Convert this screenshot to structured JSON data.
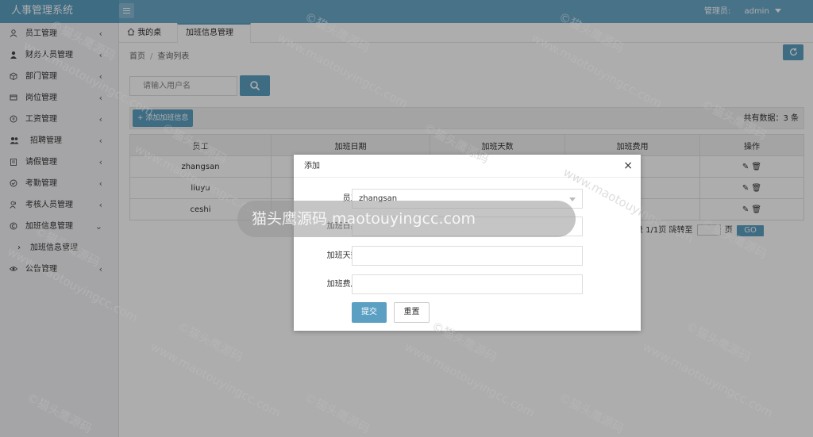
{
  "app": {
    "title": "人事管理系统"
  },
  "header": {
    "user_label": "管理员:",
    "username": "admin"
  },
  "sidebar": {
    "items": [
      {
        "label": "员工管理",
        "icon": "user-icon"
      },
      {
        "label": "财务人员管理",
        "icon": "person-icon"
      },
      {
        "label": "部门管理",
        "icon": "cube-icon"
      },
      {
        "label": "岗位管理",
        "icon": "card-icon"
      },
      {
        "label": "工资管理",
        "icon": "coin-icon"
      },
      {
        "label": "招聘管理",
        "icon": "group-icon"
      },
      {
        "label": "请假管理",
        "icon": "clipboard-icon"
      },
      {
        "label": "考勤管理",
        "icon": "check-circle-icon"
      },
      {
        "label": "考核人员管理",
        "icon": "users-icon"
      },
      {
        "label": "加班信息管理",
        "icon": "copyright-icon"
      }
    ],
    "subitem": {
      "label": "加班信息管理"
    },
    "last_item": {
      "label": "公告管理",
      "icon": "eye-icon"
    }
  },
  "tabs": {
    "home": "我的桌面",
    "active": "加班信息管理",
    "close": "×"
  },
  "breadcrumb": {
    "home": "首页",
    "sep": "/",
    "current": "查询列表"
  },
  "search": {
    "placeholder": "请输入用户名"
  },
  "toolbar": {
    "add_label": "+ 添加加班信息",
    "count_text": "共有数据：3 条"
  },
  "table": {
    "headers": [
      "员工",
      "加班日期",
      "加班天数",
      "加班费用",
      "操作"
    ],
    "rows": [
      {
        "employee": "zhangsan"
      },
      {
        "employee": "liuyu"
      },
      {
        "employee": "ceshi"
      }
    ],
    "ops": "✎ 🗑"
  },
  "pager": {
    "text": "录 1/1页 跳转至",
    "page_suffix": "页",
    "go": "GO"
  },
  "modal": {
    "title": "添加",
    "close": "×",
    "fields": {
      "employee_label": "员工:",
      "employee_value": "zhangsan",
      "date_label": "加班日期:",
      "days_label": "加班天数:",
      "fee_label": "加班费用:"
    },
    "submit": "提交",
    "reset": "重置"
  },
  "watermark": {
    "banner": "猫头鹰源码 maotouyingcc.com",
    "stamp_cn": "©猫头鹰源码",
    "stamp_url": "www.maotouyingcc.com"
  },
  "colors": {
    "primary": "#5b9fc2",
    "header": "#6aa9c9"
  }
}
